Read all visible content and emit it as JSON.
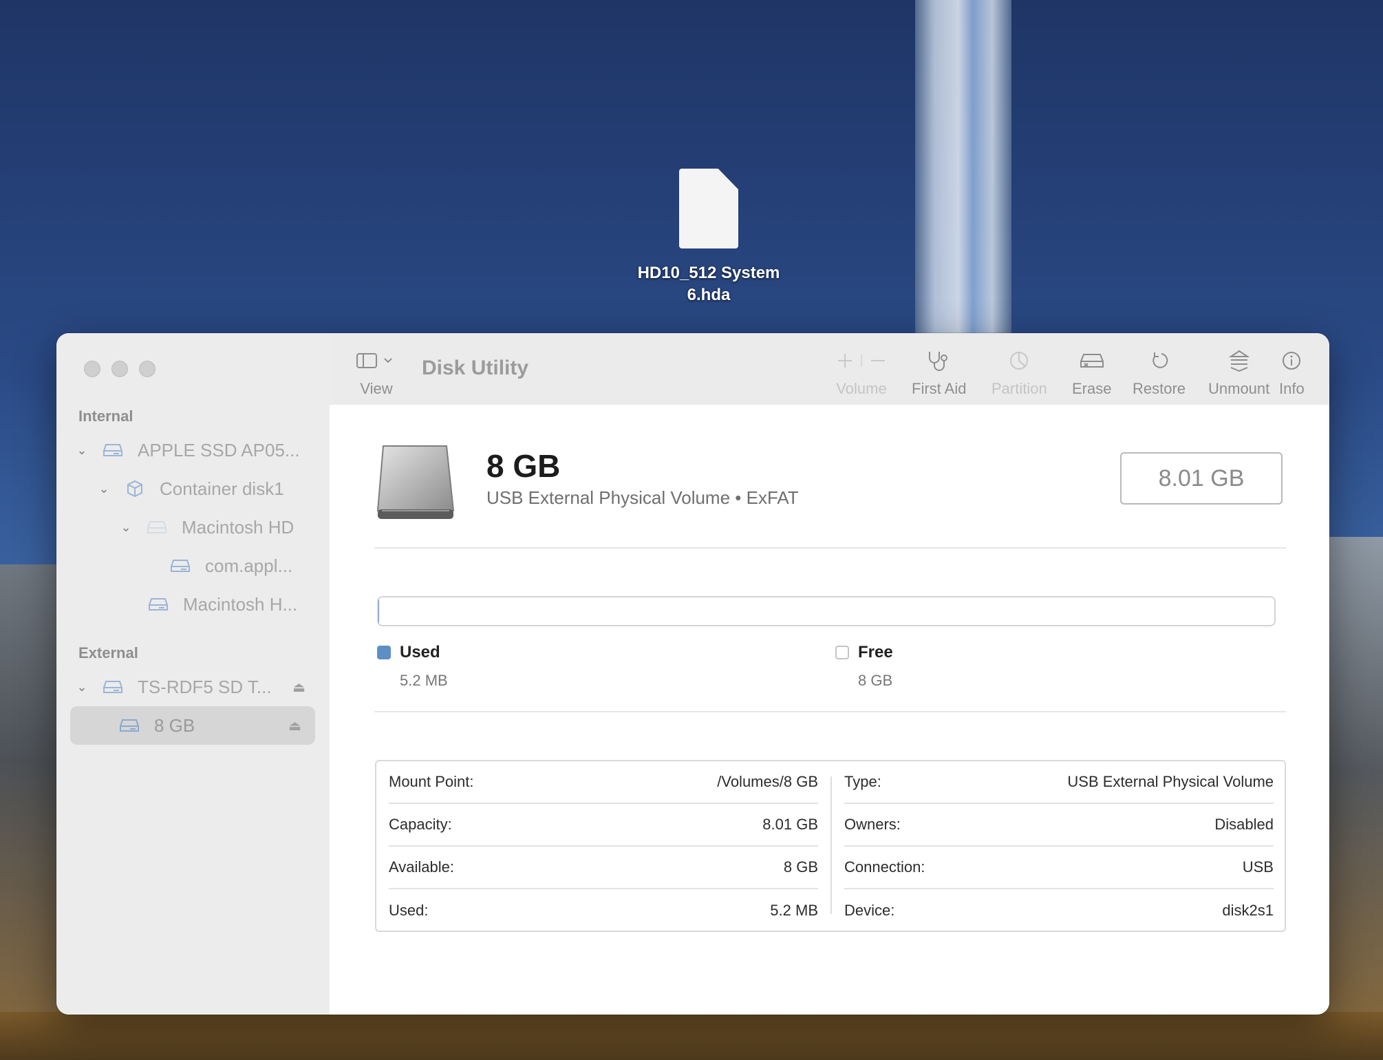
{
  "desktop": {
    "file_name": "HD10_512 System 6.hda"
  },
  "window": {
    "toolbar": {
      "title": "Disk Utility",
      "view_label": "View",
      "volume_label": "Volume",
      "first_aid_label": "First Aid",
      "partition_label": "Partition",
      "erase_label": "Erase",
      "restore_label": "Restore",
      "unmount_label": "Unmount",
      "info_label": "Info"
    },
    "sidebar": {
      "internal_header": "Internal",
      "external_header": "External",
      "items": [
        {
          "label": "APPLE SSD AP05...",
          "icon": "drive-icon",
          "expanded": true
        },
        {
          "label": "Container disk1",
          "icon": "container-icon",
          "expanded": true
        },
        {
          "label": "Macintosh HD",
          "icon": "volume-icon",
          "expanded": true
        },
        {
          "label": "com.appl...",
          "icon": "drive-icon"
        },
        {
          "label": "Macintosh H...",
          "icon": "drive-icon"
        },
        {
          "label": "TS-RDF5 SD T...",
          "icon": "drive-icon",
          "expanded": true,
          "ejectable": true
        },
        {
          "label": "8 GB",
          "icon": "drive-icon",
          "selected": true,
          "ejectable": true
        }
      ]
    },
    "volume": {
      "name": "8 GB",
      "subtitle": "USB External Physical Volume • ExFAT",
      "size": "8.01 GB",
      "used_fraction": 0.00065,
      "used_label": "Used",
      "used_value": "5.2 MB",
      "free_label": "Free",
      "free_value": "8 GB",
      "used_color": "#5d8fc4"
    },
    "details": {
      "left": [
        {
          "key": "Mount Point:",
          "value": "/Volumes/8 GB"
        },
        {
          "key": "Capacity:",
          "value": "8.01 GB"
        },
        {
          "key": "Available:",
          "value": "8 GB"
        },
        {
          "key": "Used:",
          "value": "5.2 MB"
        }
      ],
      "right": [
        {
          "key": "Type:",
          "value": "USB External Physical Volume"
        },
        {
          "key": "Owners:",
          "value": "Disabled"
        },
        {
          "key": "Connection:",
          "value": "USB"
        },
        {
          "key": "Device:",
          "value": "disk2s1"
        }
      ]
    }
  }
}
